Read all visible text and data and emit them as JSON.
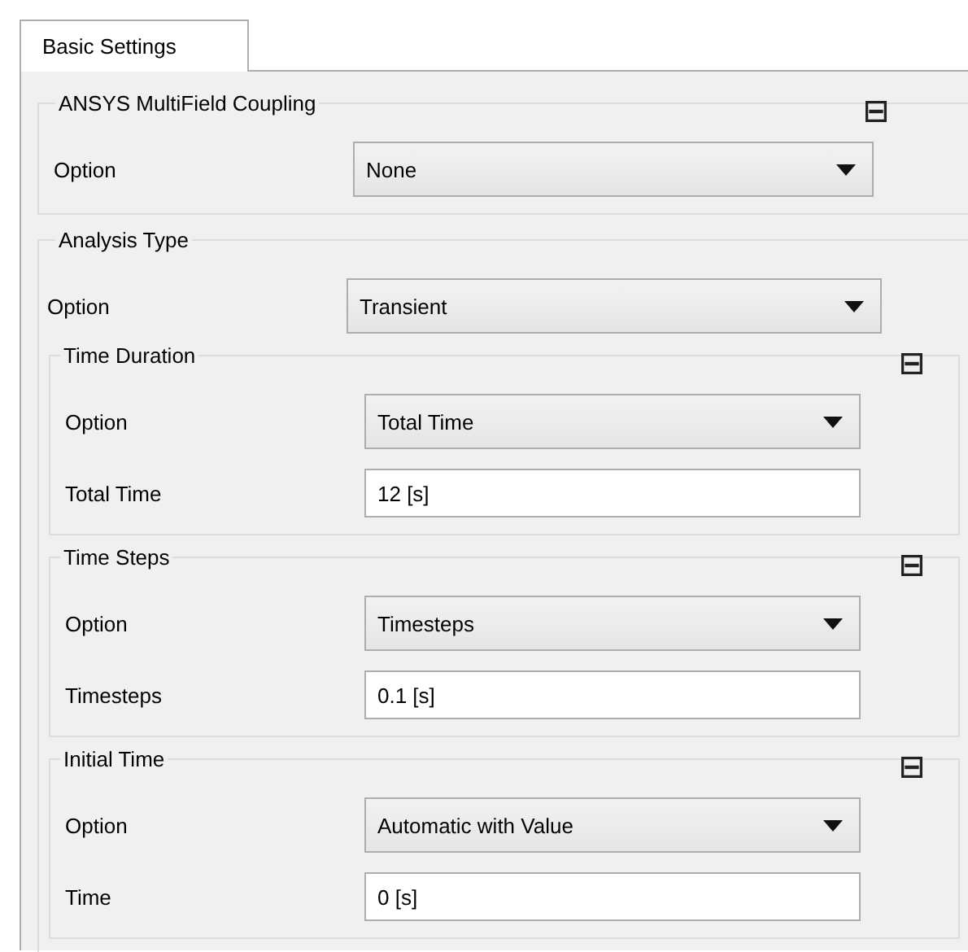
{
  "tabs": [
    {
      "label": "Basic Settings",
      "selected": true
    }
  ],
  "groups": [
    {
      "title": "ANSYS MultiField Coupling",
      "expanded": true,
      "rows": [
        {
          "kind": "dropdown",
          "label": "Option",
          "value": "None"
        }
      ]
    },
    {
      "title": "Analysis Type",
      "rows": [
        {
          "kind": "dropdown",
          "label": "Option",
          "value": "Transient"
        }
      ],
      "children": [
        {
          "title": "Time Duration",
          "expanded": true,
          "rows": [
            {
              "kind": "dropdown",
              "label": "Option",
              "value": "Total Time"
            },
            {
              "kind": "input",
              "label": "Total Time",
              "value": "12 [s]"
            }
          ]
        },
        {
          "title": "Time Steps",
          "expanded": true,
          "rows": [
            {
              "kind": "dropdown",
              "label": "Option",
              "value": "Timesteps"
            },
            {
              "kind": "input",
              "label": "Timesteps",
              "value": "0.1 [s]"
            }
          ]
        },
        {
          "title": "Initial Time",
          "expanded": true,
          "rows": [
            {
              "kind": "dropdown",
              "label": "Option",
              "value": "Automatic with Value"
            },
            {
              "kind": "input",
              "label": "Time",
              "value": "0 [s]"
            }
          ]
        }
      ]
    }
  ]
}
